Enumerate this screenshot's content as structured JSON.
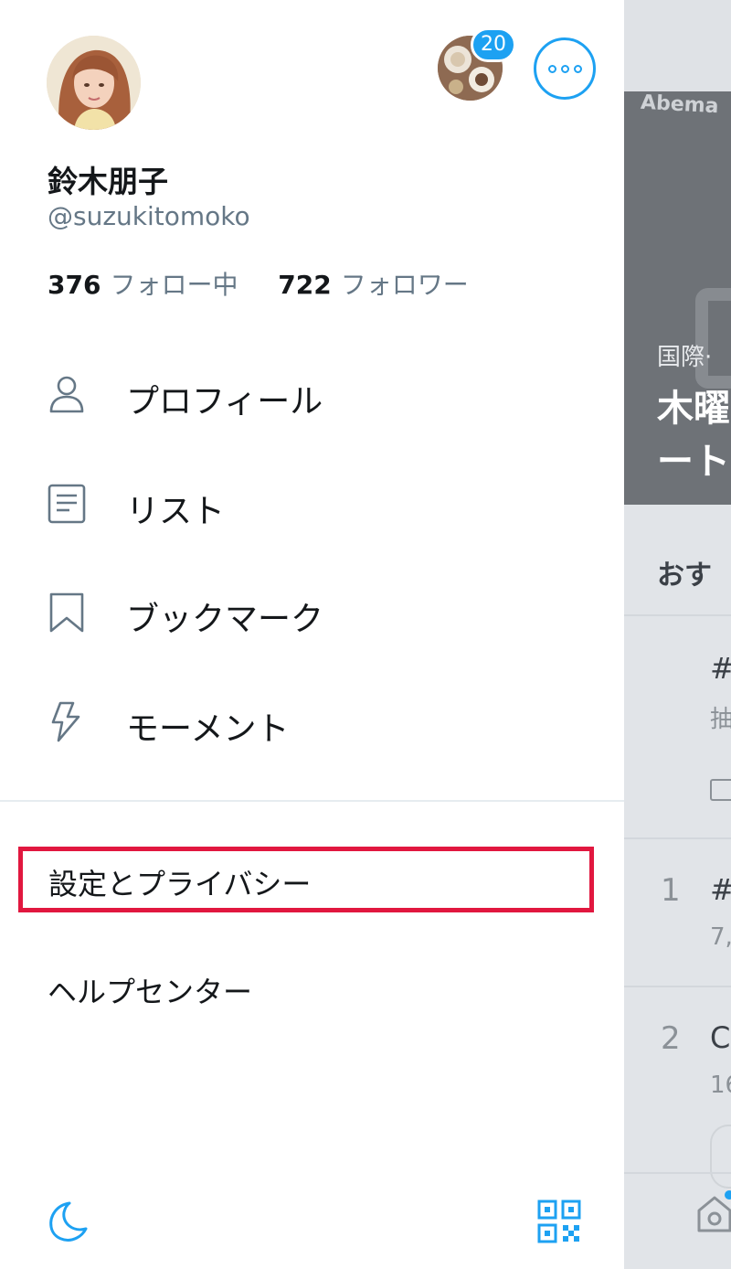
{
  "drawer": {
    "profile": {
      "display_name": "鈴木朋子",
      "handle": "@suzukitomoko",
      "following_count": "376",
      "following_label": "フォロー中",
      "followers_count": "722",
      "followers_label": "フォロワー"
    },
    "notification_badge": "20",
    "menu": [
      {
        "label": "プロフィール",
        "icon": "person-icon"
      },
      {
        "label": "リスト",
        "icon": "list-icon"
      },
      {
        "label": "ブックマーク",
        "icon": "bookmark-icon"
      },
      {
        "label": "モーメント",
        "icon": "lightning-icon"
      }
    ],
    "settings_label": "設定とプライバシー",
    "help_label": "ヘルプセンター",
    "footer": {
      "left_icon": "moon-icon",
      "right_icon": "qr-code-icon"
    }
  },
  "background_feed": {
    "banner_logo": "Abema",
    "banner_category": "国際·",
    "banner_headline_lines": [
      "木曜",
      "ート"
    ],
    "section_title": "おす",
    "trends": [
      {
        "rank": "",
        "title": "#",
        "sub": "抽"
      },
      {
        "rank": "1",
        "title": "#",
        "sub": "7,"
      },
      {
        "rank": "2",
        "title": "C",
        "sub": "16"
      }
    ]
  },
  "colors": {
    "accent": "#1da1f2",
    "highlight_border": "#e1173f",
    "text_primary": "#14171a",
    "text_secondary": "#657786"
  }
}
